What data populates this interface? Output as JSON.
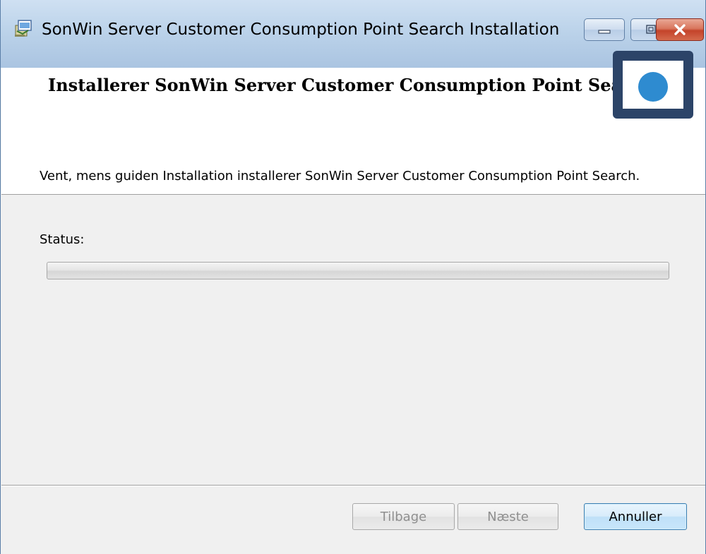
{
  "window": {
    "title": "SonWin Server Customer Consumption Point Search Installation"
  },
  "icons": {
    "app": "installer-package-icon",
    "minimize": "minimize-icon",
    "maximize": "maximize-icon",
    "close": "close-icon",
    "logo": "brand-logo-icon"
  },
  "banner": {
    "title": "Installerer SonWin Server Customer Consumption Point Search"
  },
  "body": {
    "message": "Vent, mens guiden Installation installerer SonWin Server Customer Consumption Point Search.",
    "status_label": "Status:",
    "progress": 0
  },
  "buttons": {
    "back": "Tilbage",
    "next": "Næste",
    "cancel": "Annuller"
  },
  "colors": {
    "logo_frame": "#2c4468",
    "logo_dot": "#2e8bd0",
    "close_button": "#c4432a"
  }
}
